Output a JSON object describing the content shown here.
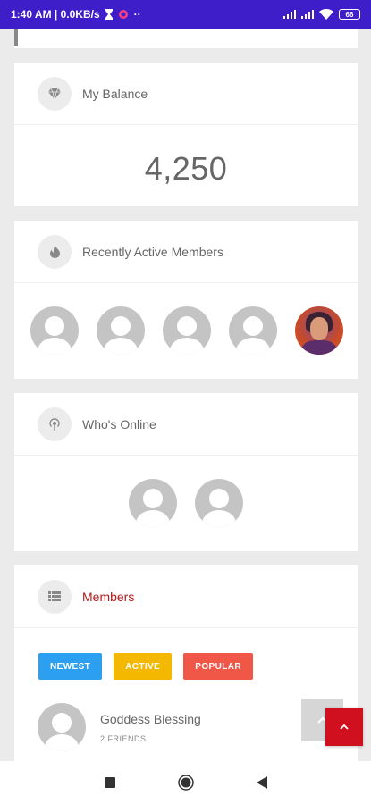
{
  "status_bar": {
    "time_info": "1:40 AM | 0.0KB/s",
    "extra": "··",
    "battery": "66"
  },
  "balance": {
    "title": "My Balance",
    "value": "4,250"
  },
  "recent": {
    "title": "Recently Active Members"
  },
  "online": {
    "title": "Who's Online"
  },
  "members": {
    "title": "Members",
    "tabs": [
      {
        "label": "NEWEST",
        "color": "#2d9ff0"
      },
      {
        "label": "ACTIVE",
        "color": "#f5b800"
      },
      {
        "label": "POPULAR",
        "color": "#f05747"
      }
    ],
    "list": [
      {
        "name": "Goddess Blessing",
        "friends": "2 FRIENDS"
      }
    ]
  },
  "colors": {
    "status_bar": "#3d1ec9",
    "fab_red": "#d0101e",
    "members_title": "#b21a1a"
  }
}
